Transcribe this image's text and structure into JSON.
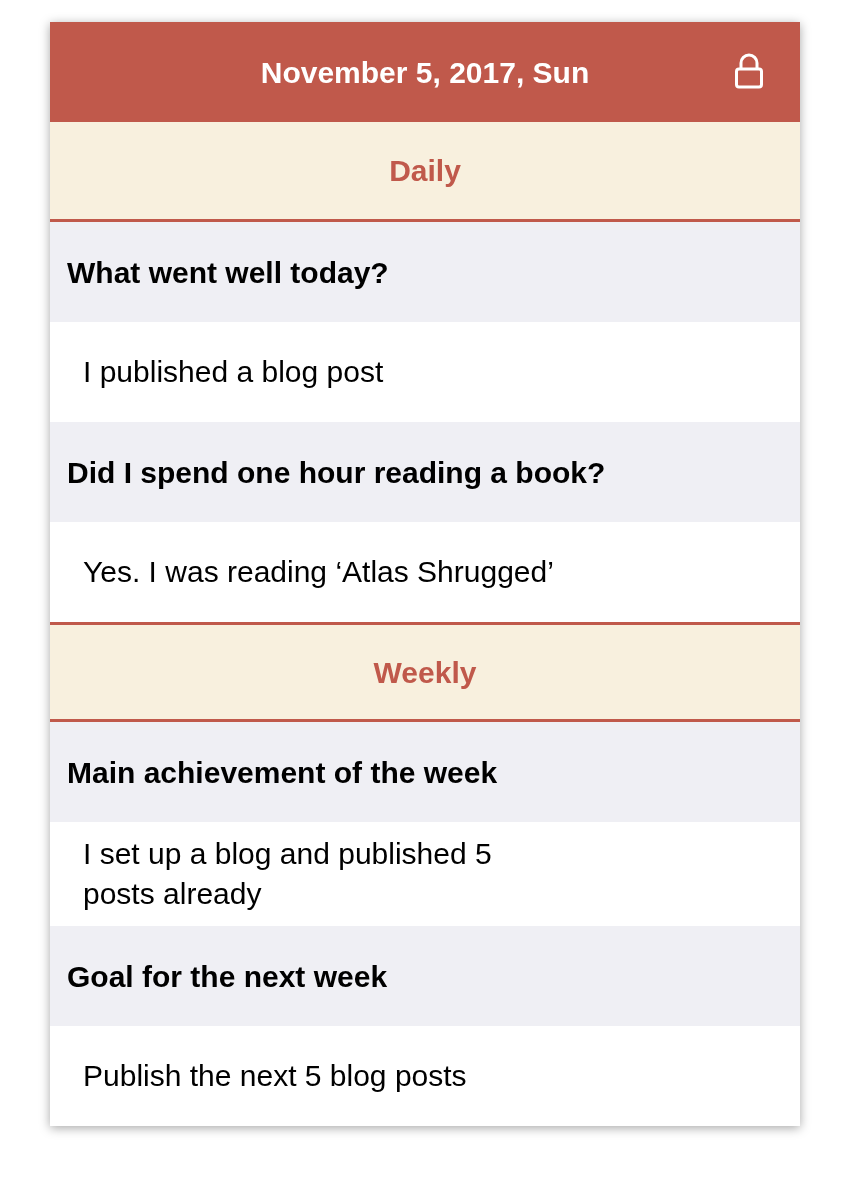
{
  "header": {
    "title": "November 5, 2017, Sun",
    "locked": true
  },
  "sections": [
    {
      "title": "Daily",
      "entries": [
        {
          "question": "What went well today?",
          "answer": "I published a blog post"
        },
        {
          "question": "Did I spend one hour reading a book?",
          "answer": "Yes. I was reading ‘Atlas Shrugged’"
        }
      ]
    },
    {
      "title": "Weekly",
      "entries": [
        {
          "question": "Main achievement of the week",
          "answer": "I set up a blog and published 5\nposts already"
        },
        {
          "question": "Goal for the next week",
          "answer": "Publish the next 5 blog posts"
        }
      ]
    }
  ]
}
